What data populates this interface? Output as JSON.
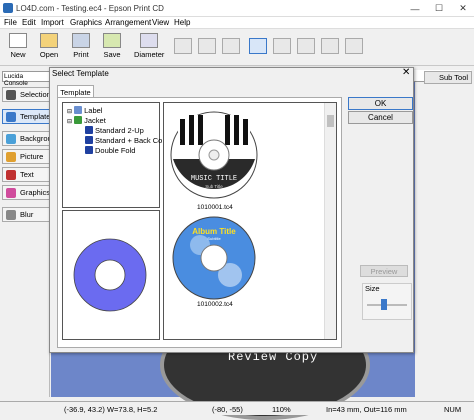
{
  "window": {
    "title": "LO4D.com - Testing.ec4 - Epson Print CD",
    "minimize": "—",
    "maximize": "☐",
    "close": "✕"
  },
  "menu": [
    "File",
    "Edit",
    "Import",
    "Graphics",
    "Arrangement",
    "View",
    "Help"
  ],
  "toolbar": {
    "new": "New",
    "open": "Open",
    "print": "Print",
    "save": "Save",
    "diameter": "Diameter"
  },
  "sidebar": {
    "font": "Lucida Console",
    "items": [
      "Selection",
      "Template",
      "Backgrou",
      "Picture",
      "Text",
      "Graphics",
      "Blur"
    ]
  },
  "subtool": "Sub Tool",
  "dialog": {
    "title": "Select Template",
    "close": "✕",
    "tab": "Template",
    "tree": {
      "label": "Label",
      "jacket": "Jacket",
      "children": [
        "Standard 2-Up",
        "Standard + Back Co",
        "Double Fold"
      ]
    },
    "thumbs": [
      {
        "file": "1010001.tc4",
        "title": "MUSIC TITLE",
        "subtitle": "Sub Title"
      },
      {
        "file": "1010002.tc4",
        "title": "Album Title",
        "subtitle": "Subtitle"
      }
    ],
    "ok": "OK",
    "cancel": "Cancel",
    "preview": "Preview",
    "size": "Size"
  },
  "canvas_text": "Review Copy",
  "status": {
    "coords": "(-36.9, 43.2) W=73.8, H=5.2",
    "offset": "(-80, -55)",
    "zoom": "110%",
    "info": "In=43 mm, Out=116 mm",
    "num": "NUM"
  },
  "colors": {
    "canvas": "#6d86c9",
    "accent": "#3a78c9",
    "preview_disc": "#6b6bf0"
  }
}
